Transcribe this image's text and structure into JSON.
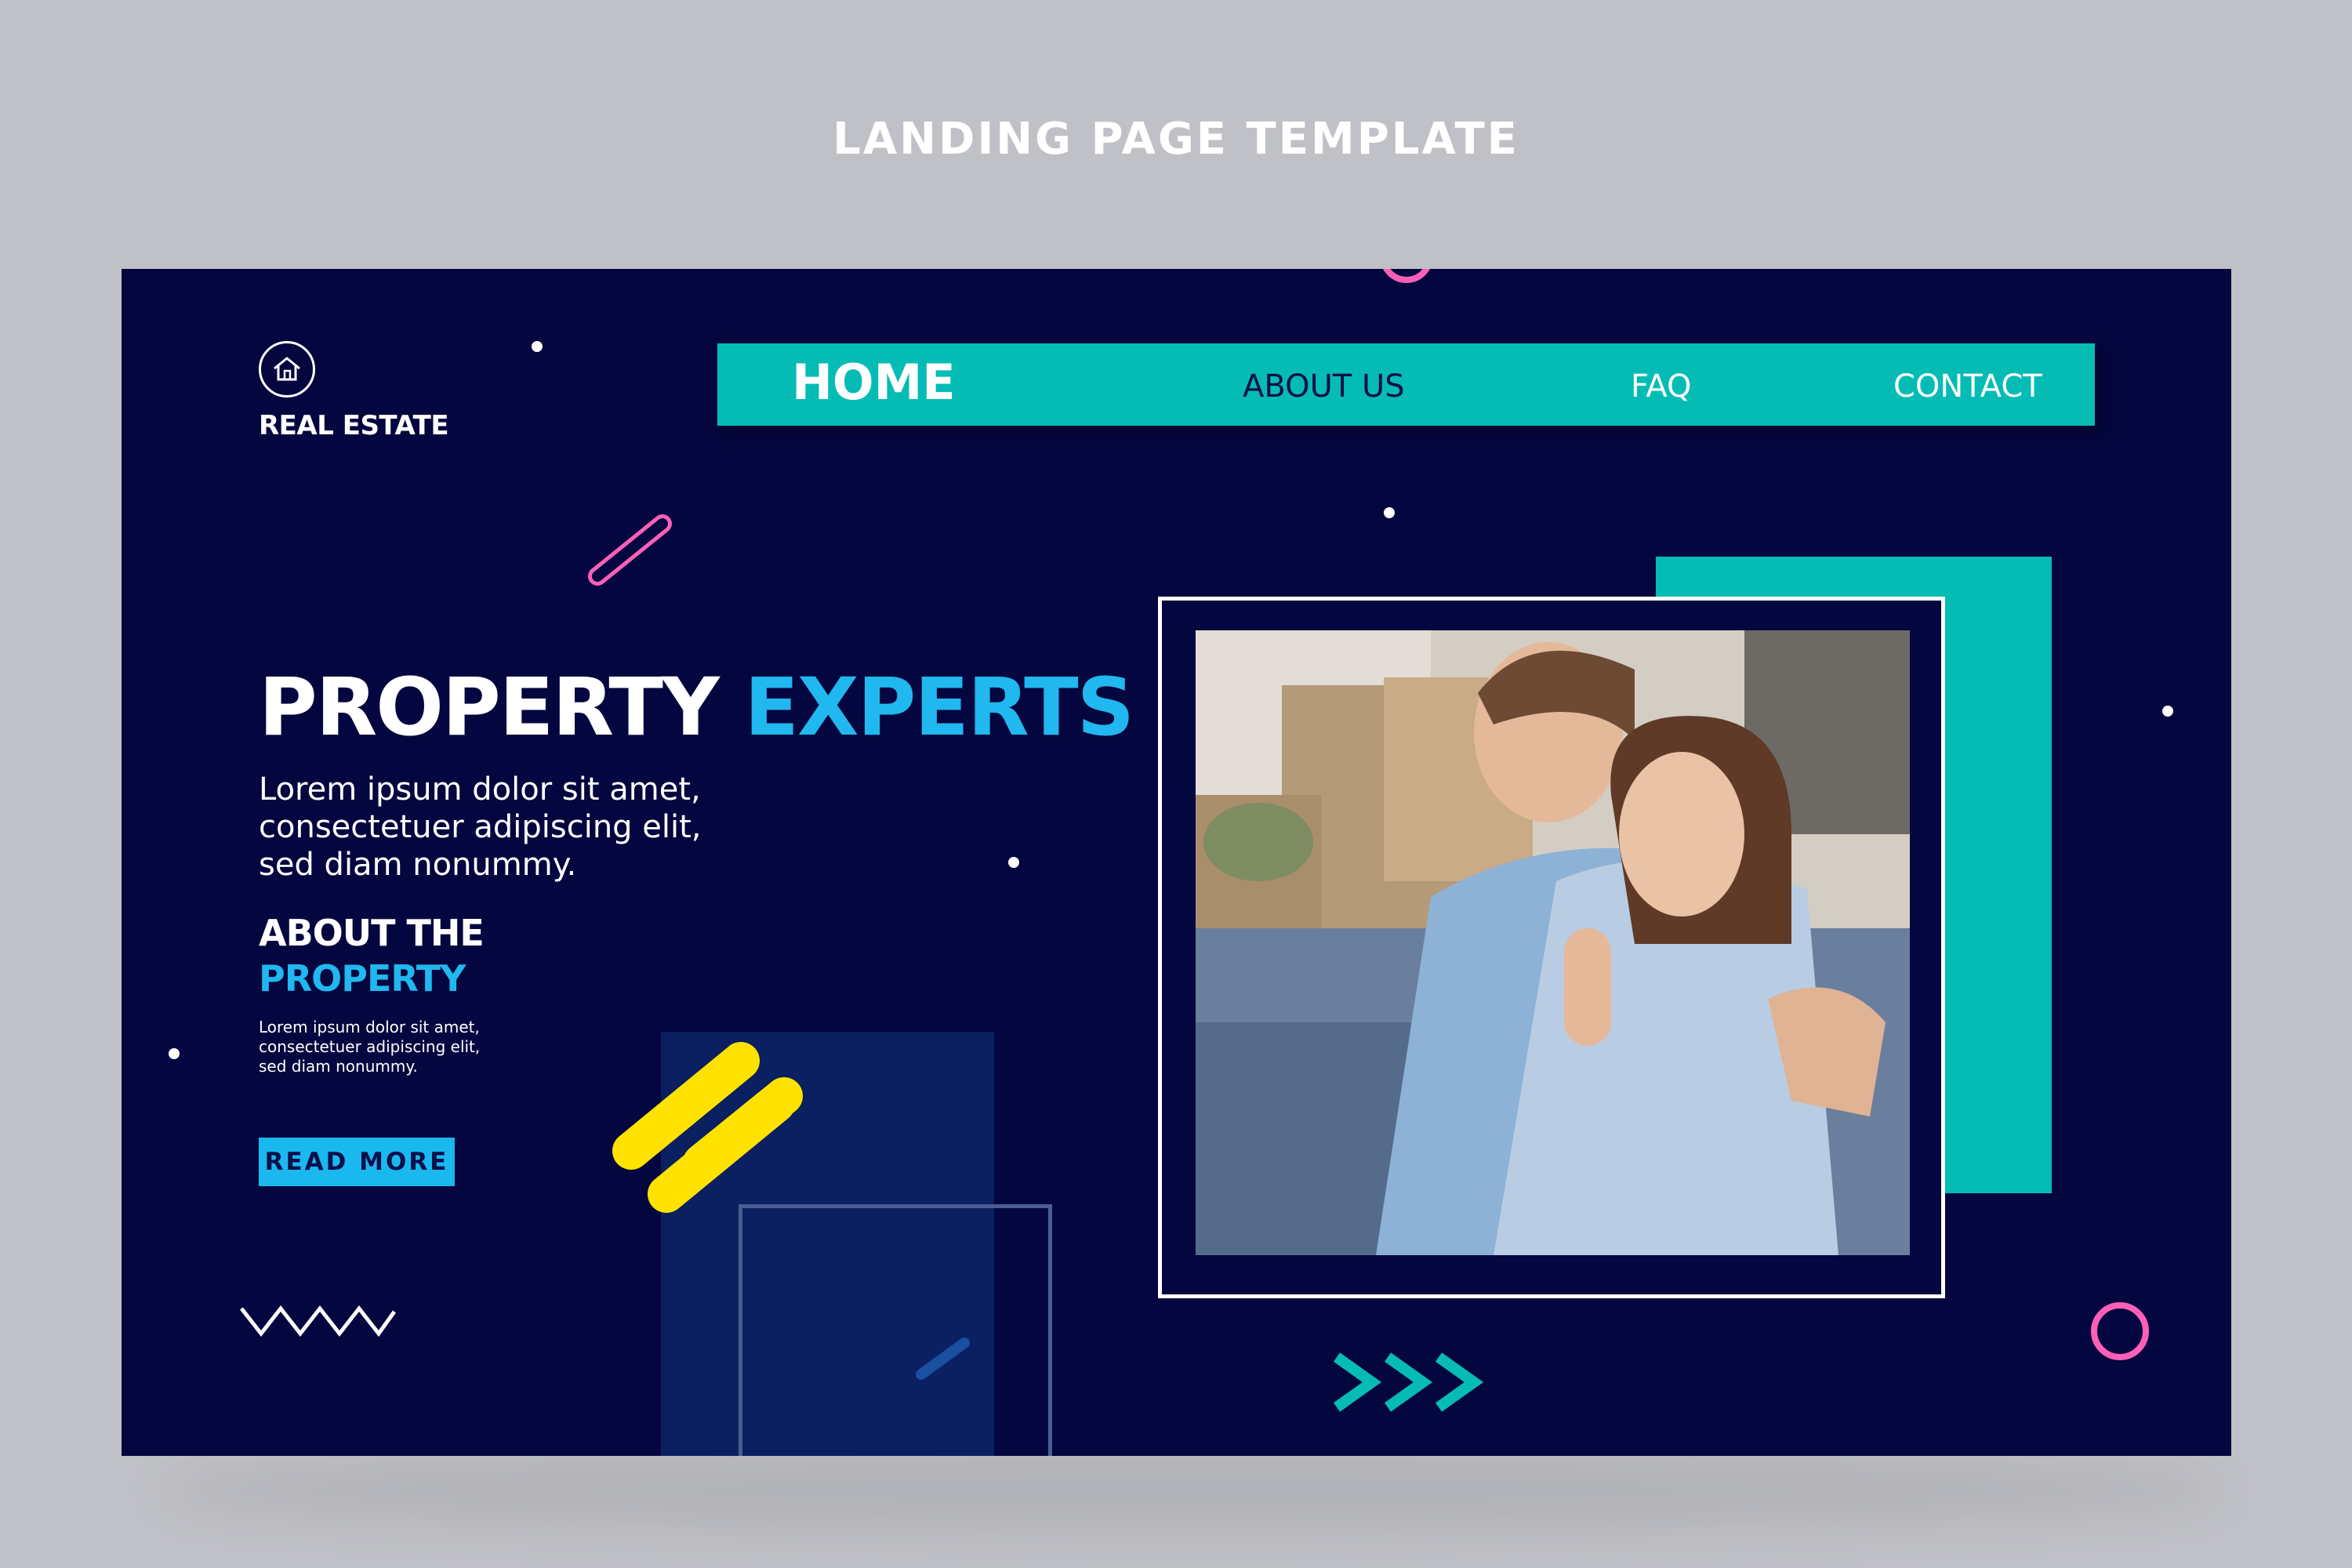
{
  "page": {
    "title": "LANDING PAGE TEMPLATE"
  },
  "logo": {
    "icon": "house-icon",
    "text": "REAL ESTATE"
  },
  "nav": {
    "items": [
      {
        "label": "HOME",
        "active": true
      },
      {
        "label": "ABOUT US",
        "active": false
      },
      {
        "label": "FAQ",
        "active": false
      },
      {
        "label": "CONTACT",
        "active": false
      }
    ]
  },
  "hero": {
    "title_part1": "PROPERTY",
    "title_part2": "EXPERTS",
    "description_lines": [
      "Lorem ipsum dolor sit amet,",
      "consectetuer adipiscing elit,",
      "sed diam nonummy."
    ]
  },
  "about": {
    "heading_line1": "ABOUT THE",
    "heading_line2": "PROPERTY",
    "description_lines": [
      "Lorem ipsum dolor sit amet,",
      "consectetuer adipiscing elit,",
      "sed diam nonummy."
    ],
    "button_label": "READ MORE"
  },
  "colors": {
    "background": "#c0c1c6",
    "card": "#04063f",
    "teal": "#05bcb5",
    "accent_blue": "#20b8ee",
    "pink": "#ff5fb8",
    "yellow": "#ffe200"
  }
}
